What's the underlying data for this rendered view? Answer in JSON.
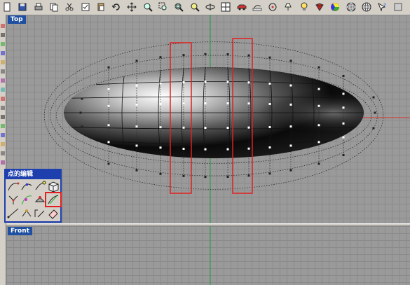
{
  "viewports": {
    "top": {
      "label": "Top"
    },
    "front": {
      "label": "Front"
    }
  },
  "panel": {
    "title": "点的编辑"
  },
  "colors": {
    "accent": "#1e3fae",
    "grid": "#9a9a9a",
    "grid_line": "#8a8a8a",
    "axis_red": "#d43030",
    "axis_green": "#20a040",
    "highlight_red": "#e02020"
  },
  "toolbar_icons": [
    "new-file-icon",
    "save-icon",
    "print-icon",
    "copy-icon",
    "cut-icon",
    "select-icon",
    "paste-icon",
    "undo-icon",
    "pan-icon",
    "zoom-icon",
    "zoom-window-icon",
    "zoom-extents-icon",
    "zoom-selected-icon",
    "rotate-view-icon",
    "four-viewports-icon",
    "car-icon",
    "sketch-icon",
    "grid-snap-icon",
    "light-icon",
    "light-bulb-icon",
    "render-icon",
    "color-wheel-icon",
    "sphere-icon",
    "settings-sphere-icon",
    "help-icon",
    "extra-icon"
  ],
  "panel_icons": [
    "curve-point-icon",
    "edit-curve-icon",
    "handle-icon",
    "box-points-icon",
    "split-point-icon",
    "pull-point-icon",
    "move-uvn-icon",
    "smooth-icon",
    "line-icon",
    "scale-icon",
    "hinge-icon",
    "eraser-icon"
  ]
}
